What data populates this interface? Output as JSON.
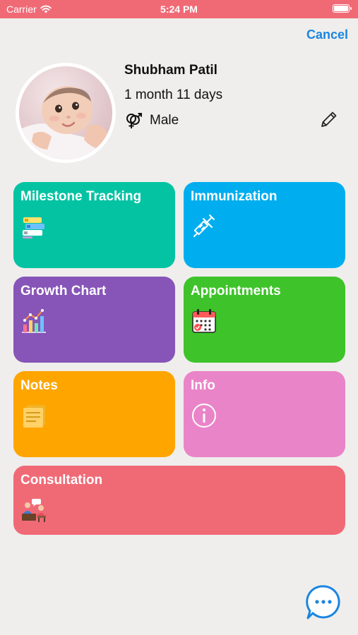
{
  "status_bar": {
    "carrier": "Carrier",
    "time": "5:24 PM"
  },
  "header": {
    "cancel_label": "Cancel"
  },
  "profile": {
    "name": "Shubham Patil",
    "age": "1 month 11 days",
    "gender": "Male"
  },
  "tiles": [
    {
      "title": "Milestone Tracking",
      "color": "#04c3a3",
      "icon": "milestone-blocks-icon"
    },
    {
      "title": "Immunization",
      "color": "#00aeef",
      "icon": "syringe-icon"
    },
    {
      "title": "Growth Chart",
      "color": "#8755b8",
      "icon": "growth-chart-icon"
    },
    {
      "title": "Appointments",
      "color": "#3fc32a",
      "icon": "calendar-icon"
    },
    {
      "title": "Notes",
      "color": "#ffa500",
      "icon": "notes-icon"
    },
    {
      "title": "Info",
      "color": "#ea84c8",
      "icon": "info-icon"
    },
    {
      "title": "Consultation",
      "color": "#f06a76",
      "icon": "consultation-icon"
    }
  ],
  "colors": {
    "accent": "#1a86e0",
    "status_bar": "#f06a76",
    "background": "#efeeec"
  }
}
